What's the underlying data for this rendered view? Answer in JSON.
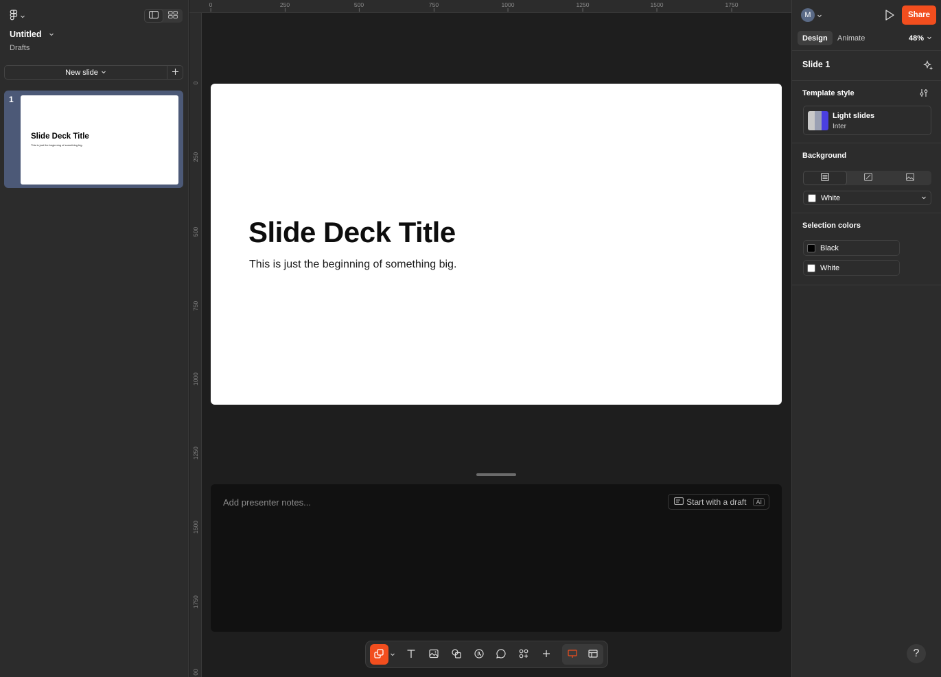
{
  "left_panel": {
    "file_title": "Untitled",
    "file_location": "Drafts",
    "new_slide_label": "New slide",
    "slides": [
      {
        "number": "1",
        "title": "Slide Deck Title",
        "subtitle": "This is just the beginning of something big."
      }
    ]
  },
  "rulers": {
    "horizontal": [
      "0",
      "250",
      "500",
      "750",
      "1000",
      "1250",
      "1500",
      "1750"
    ],
    "vertical": [
      "0",
      "250",
      "500",
      "750",
      "1000",
      "1250",
      "1500",
      "1750",
      "00"
    ]
  },
  "canvas": {
    "slide_title": "Slide Deck Title",
    "slide_subtitle": "This is just the beginning of something big.",
    "notes_placeholder": "Add presenter notes...",
    "draft_button_label": "Start with a draft",
    "ai_badge": "AI"
  },
  "right_panel": {
    "avatar_initial": "M",
    "share_label": "Share",
    "tabs": {
      "design": "Design",
      "animate": "Animate"
    },
    "zoom": "48%",
    "slide_name": "Slide 1",
    "template_section": "Template style",
    "template_name": "Light slides",
    "template_font": "Inter",
    "background_section": "Background",
    "background_value": "White",
    "selection_colors_section": "Selection colors",
    "selection_colors": [
      {
        "name": "Black",
        "hex": "#000000"
      },
      {
        "name": "White",
        "hex": "#ffffff"
      }
    ]
  },
  "theme": {
    "accent": "#f24e1e",
    "selected_thumb": "#4c5977"
  }
}
